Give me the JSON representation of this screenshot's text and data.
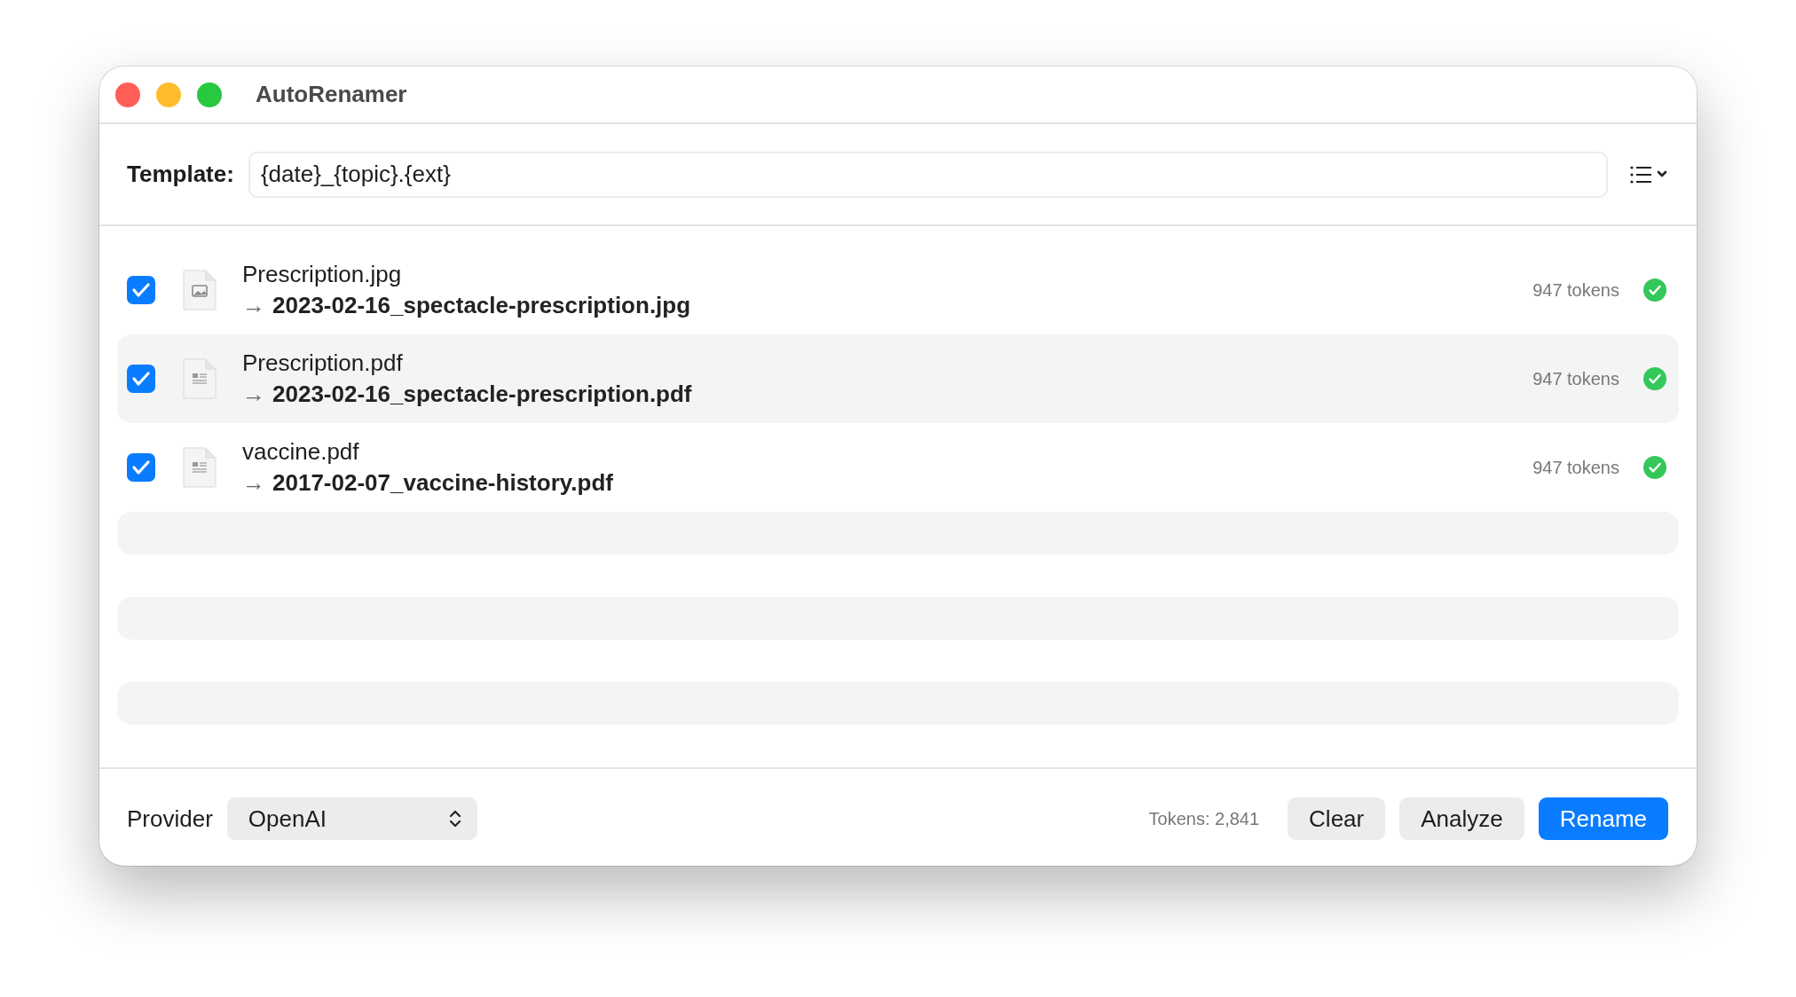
{
  "window": {
    "title": "AutoRenamer"
  },
  "template": {
    "label": "Template:",
    "value": "{date}_{topic}.{ext}"
  },
  "files": [
    {
      "name": "Prescription.jpg",
      "kind": "image",
      "arrow": "→",
      "new_name": "2023-02-16_spectacle-prescription.jpg",
      "tokens": "947 tokens",
      "checked": true,
      "done": true
    },
    {
      "name": "Prescription.pdf",
      "kind": "document",
      "arrow": "→",
      "new_name": "2023-02-16_spectacle-prescription.pdf",
      "tokens": "947 tokens",
      "checked": true,
      "done": true
    },
    {
      "name": "vaccine.pdf",
      "kind": "document",
      "arrow": "→",
      "new_name": "2017-02-07_vaccine-history.pdf",
      "tokens": "947 tokens",
      "checked": true,
      "done": true
    }
  ],
  "footer": {
    "provider_label": "Provider",
    "provider": "OpenAI",
    "tokens": "Tokens: 2,841",
    "buttons": [
      {
        "label": "Clear",
        "kind": "secondary"
      },
      {
        "label": "Analyze",
        "kind": "secondary"
      },
      {
        "label": "Rename",
        "kind": "primary"
      }
    ]
  }
}
